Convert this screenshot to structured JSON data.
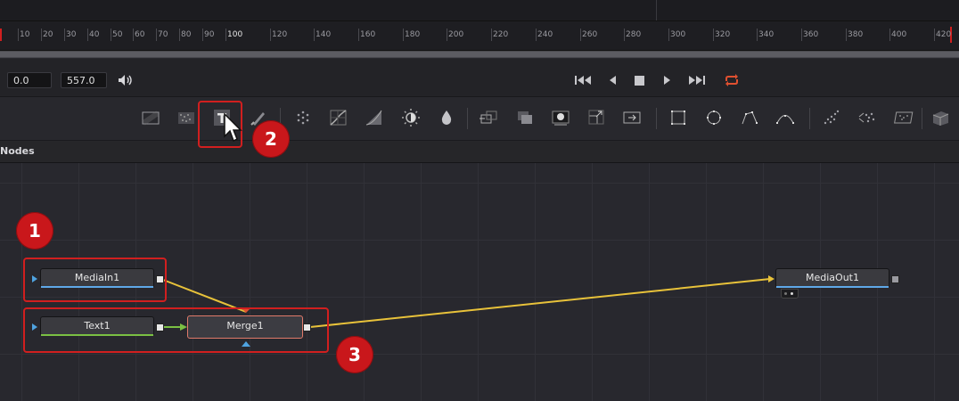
{
  "ruler": {
    "labels": [
      "10",
      "20",
      "30",
      "40",
      "50",
      "60",
      "70",
      "80",
      "90",
      "100",
      "120",
      "140",
      "160",
      "180",
      "200",
      "220",
      "240",
      "260",
      "280",
      "300",
      "320",
      "340",
      "360",
      "380",
      "400",
      "420"
    ]
  },
  "transport": {
    "start_value": "0.0",
    "end_value": "557.0",
    "icons": [
      "speaker-icon",
      "skip-to-start-icon",
      "play-reverse-icon",
      "stop-icon",
      "play-icon",
      "skip-to-end-icon",
      "loop-icon"
    ]
  },
  "toolbar": {
    "tools": [
      "background-tool",
      "fast-noise-tool",
      "text-tool",
      "paint-tool",
      "particles-tool",
      "color-curves-tool",
      "brightness-contrast-tool",
      "color-corrector-tool",
      "blur-tool",
      "channel-booleans-tool",
      "dissolve-tool",
      "matte-control-tool",
      "resize-tool",
      "transform-tool",
      "rectangle-mask-tool",
      "ellipse-mask-tool",
      "polygon-mask-tool",
      "bspline-mask-tool",
      "particle-emitter-tool",
      "particle-render-tool",
      "shape-3d-tool",
      "renderer-3d-tool"
    ]
  },
  "panel": {
    "title": "Nodes"
  },
  "nodes": {
    "media_in": "MediaIn1",
    "text": "Text1",
    "merge": "Merge1",
    "media_out": "MediaOut1"
  },
  "annotations": {
    "badge1": "1",
    "badge2": "2",
    "badge3": "3"
  },
  "colors": {
    "accent_red": "#d11f1f",
    "link_yellow": "#e8c23a",
    "link_green": "#7bc043",
    "input_blue": "#4fa3e0",
    "loop_red": "#e05030"
  }
}
